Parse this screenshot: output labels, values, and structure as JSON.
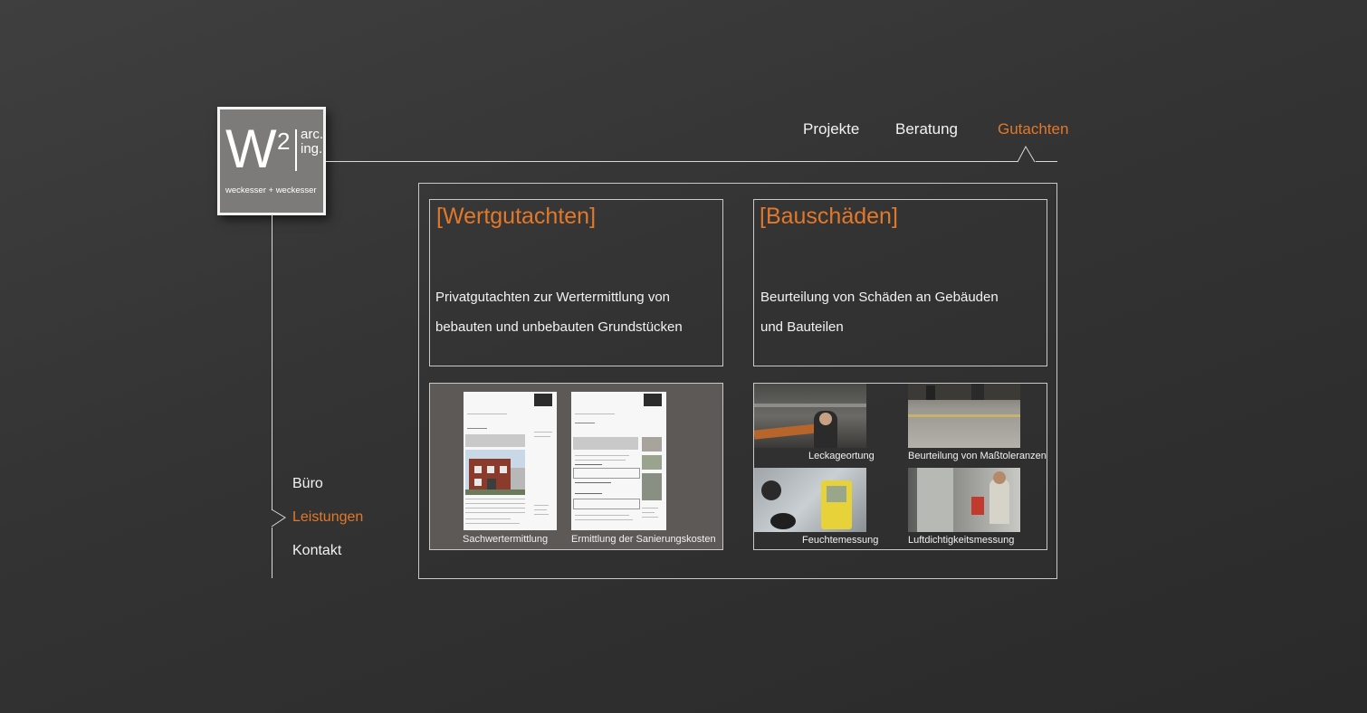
{
  "logo": {
    "letter": "W",
    "superscript": "2",
    "line1": "arc.",
    "line2": "ing.",
    "subtitle": "weckesser + weckesser"
  },
  "top_nav": {
    "items": [
      {
        "label": "Projekte",
        "active": false
      },
      {
        "label": "Beratung",
        "active": false
      },
      {
        "label": "Gutachten",
        "active": true
      }
    ]
  },
  "side_nav": {
    "items": [
      {
        "label": "Büro",
        "active": false
      },
      {
        "label": "Leistungen",
        "active": true
      },
      {
        "label": "Kontakt",
        "active": false
      }
    ]
  },
  "sections": {
    "wertgutachten": {
      "title": "[Wertgutachten]",
      "text_line1": "Privatgutachten zur Wertermittlung von",
      "text_line2": "bebauten und unbebauten Grundstücken",
      "thumbnails": [
        {
          "caption": "Sachwertermittlung"
        },
        {
          "caption": "Ermittlung der Sanierungskosten"
        }
      ]
    },
    "bauschaeden": {
      "title": "[Bauschäden]",
      "text_line1": "Beurteilung von Schäden an Gebäuden",
      "text_line2": "und Bauteilen",
      "thumbnails": [
        {
          "caption": "Leckageortung"
        },
        {
          "caption": "Beurteilung von Maßtoleranzen"
        },
        {
          "caption": "Feuchtemessung"
        },
        {
          "caption": "Luftdichtigkeitsmessung"
        }
      ]
    }
  },
  "colors": {
    "accent": "#e2782a",
    "background": "#363636",
    "line": "#d8d8d8"
  }
}
